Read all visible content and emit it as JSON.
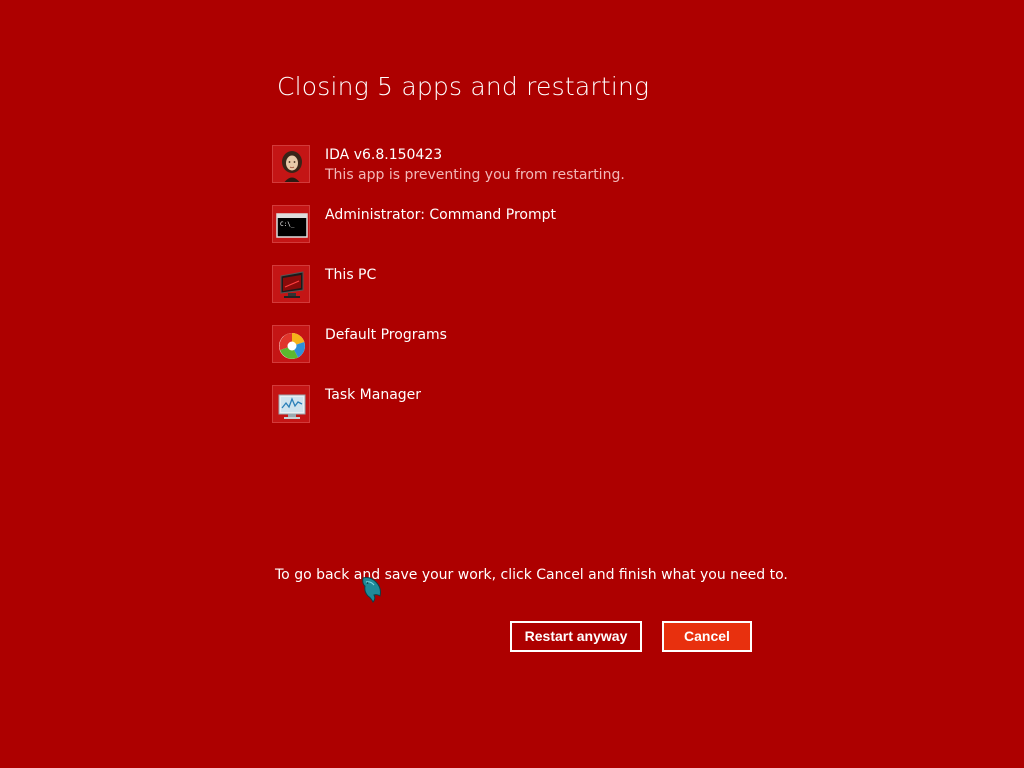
{
  "dialog": {
    "title": "Closing 5 apps and restarting",
    "hint": "To go back and save your work, click Cancel and finish what you need to."
  },
  "apps": [
    {
      "name": "IDA v6.8.150423",
      "note": "This app is preventing you from restarting.",
      "icon": "ida-portrait-icon"
    },
    {
      "name": "Administrator: Command Prompt",
      "note": "",
      "icon": "command-prompt-icon"
    },
    {
      "name": "This PC",
      "note": "",
      "icon": "this-pc-icon"
    },
    {
      "name": "Default Programs",
      "note": "",
      "icon": "default-programs-icon"
    },
    {
      "name": "Task Manager",
      "note": "",
      "icon": "task-manager-icon"
    }
  ],
  "buttons": {
    "restart_label": "Restart anyway",
    "cancel_label": "Cancel"
  },
  "colors": {
    "background": "#ad0000",
    "cancel_button": "#e8300e",
    "secondary_text": "#f2b8b8"
  },
  "cursor": {
    "icon": "dolphin-cursor-icon"
  }
}
